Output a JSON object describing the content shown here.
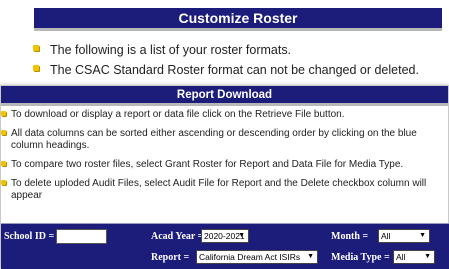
{
  "customize": {
    "title": "Customize Roster",
    "items": [
      "The following is a list of your roster formats.",
      "The CSAC Standard Roster format can not be changed or deleted."
    ]
  },
  "download": {
    "title": "Report Download",
    "items": [
      "To download or display a report or data file click on the Retrieve File button.",
      "All data columns can be sorted either ascending or descending order by clicking on the blue column headings.",
      "To compare two roster files, select Grant Roster for Report and Data File for Media Type.",
      "To delete uploded Audit Files, select Audit File for Report and the Delete checkbox column will appear"
    ]
  },
  "filters": {
    "school_id_label": "School ID =",
    "school_id_value": "",
    "acad_year_label": "Acad Year =",
    "acad_year_value": "2020-2021",
    "month_label": "Month =",
    "month_value": "All",
    "report_label": "Report =",
    "report_value": "California Dream Act ISIRs",
    "media_type_label": "Media Type =",
    "media_type_value": "All"
  },
  "icons": {
    "bullet": "yellow-square-bullet-icon",
    "dropdown": "dropdown-caret-icon"
  },
  "colors": {
    "header_bg": "#1c1c7a",
    "bullet": "#f0c400"
  }
}
